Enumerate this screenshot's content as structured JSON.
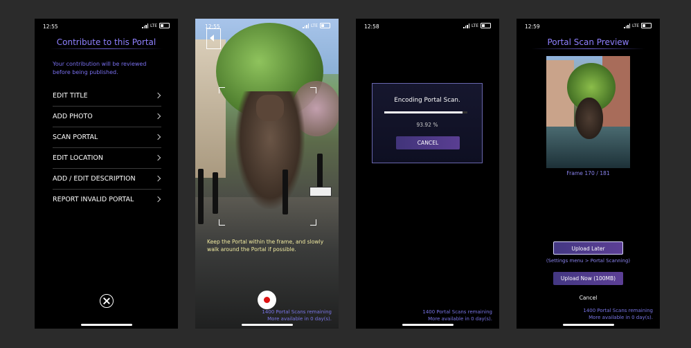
{
  "screen1": {
    "status_time": "12:55",
    "carrier": "LTE",
    "title": "Contribute to this Portal",
    "intro": "Your contribution will be reviewed before being published.",
    "menu": [
      {
        "label": "EDIT TITLE"
      },
      {
        "label": "ADD PHOTO"
      },
      {
        "label": "SCAN PORTAL"
      },
      {
        "label": "EDIT LOCATION"
      },
      {
        "label": "ADD / EDIT DESCRIPTION"
      },
      {
        "label": "REPORT INVALID PORTAL"
      }
    ],
    "close_icon": "close-circle-icon"
  },
  "screen2": {
    "status_time": "12:55",
    "carrier": "LTE",
    "instruction": "Keep the Portal within the frame, and slowly walk around the Portal if possible.",
    "remaining_line1": "1400 Portal Scans remaining",
    "remaining_line2": "More available in 0 day(s).",
    "record_icon": "record-icon",
    "back_icon": "back-icon"
  },
  "screen3": {
    "status_time": "12:58",
    "carrier": "LTE",
    "dialog_title": "Encoding Portal Scan.",
    "progress_percent": "93.92 %",
    "progress_fraction": 0.9392,
    "cancel_label": "CANCEL",
    "remaining_line1": "1400 Portal Scans remaining",
    "remaining_line2": "More available in 0 day(s)."
  },
  "screen4": {
    "status_time": "12:59",
    "carrier": "LTE",
    "title": "Portal Scan Preview",
    "frame_label": "Frame 170 / 181",
    "upload_later_label": "Upload Later",
    "settings_note": "(Settings menu > Portal Scanning)",
    "upload_now_label": "Upload Now (100MB)",
    "cancel_label": "Cancel",
    "remaining_line1": "1400 Portal Scans remaining",
    "remaining_line2": "More available in 0 day(s)."
  },
  "colors": {
    "accent": "#8f80ff",
    "button": "#4a3a8a",
    "background": "#2b2b2b",
    "record": "#dd1111"
  }
}
